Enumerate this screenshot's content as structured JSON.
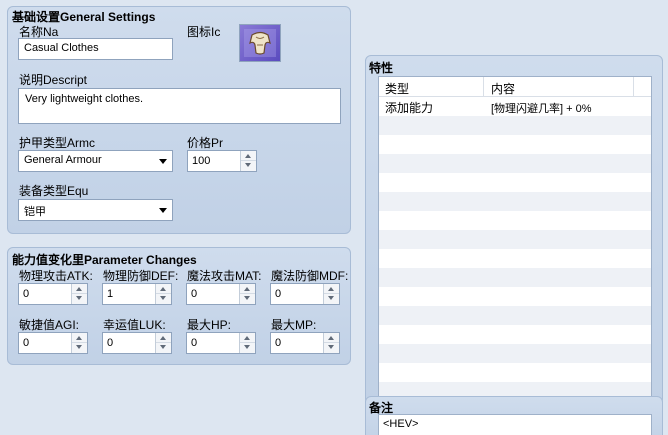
{
  "general": {
    "title": "基础设置General Settings",
    "name_label": "名称Na",
    "name_value": "Casual Clothes",
    "icon_label": "图标Ic",
    "desc_label": "说明Descript",
    "desc_value": "Very lightweight clothes.",
    "armor_type_label": "护甲类型Armc",
    "armor_type_value": "General Armour",
    "price_label": "价格Pr",
    "price_value": "100",
    "equip_type_label": "装备类型Equ",
    "equip_type_value": "铠甲"
  },
  "params": {
    "title": "能力值变化里Parameter Changes",
    "items": [
      {
        "label": "物理攻击ATK:",
        "value": "0"
      },
      {
        "label": "物理防御DEF:",
        "value": "1"
      },
      {
        "label": "魔法攻击MAT:",
        "value": "0"
      },
      {
        "label": "魔法防御MDF:",
        "value": "0"
      },
      {
        "label": "敏捷值AGI:",
        "value": "0"
      },
      {
        "label": "幸运值LUK:",
        "value": "0"
      },
      {
        "label": "最大HP:",
        "value": "0"
      },
      {
        "label": "最大MP:",
        "value": "0"
      }
    ]
  },
  "traits": {
    "title": "特性",
    "col_type": "类型",
    "col_content": "内容",
    "rows": [
      {
        "type": "添加能力",
        "content": "[物理闪避几率] + 0%"
      }
    ],
    "stripe_color": "#eef1f6"
  },
  "notes": {
    "title": "备注",
    "value": "<HEV>"
  },
  "colors": {
    "background": "#dde6f1",
    "panel": "#c8d6ea",
    "panel_border": "#a8bcd6"
  },
  "icons": {
    "armor_icon": "cloth-armor-icon"
  }
}
